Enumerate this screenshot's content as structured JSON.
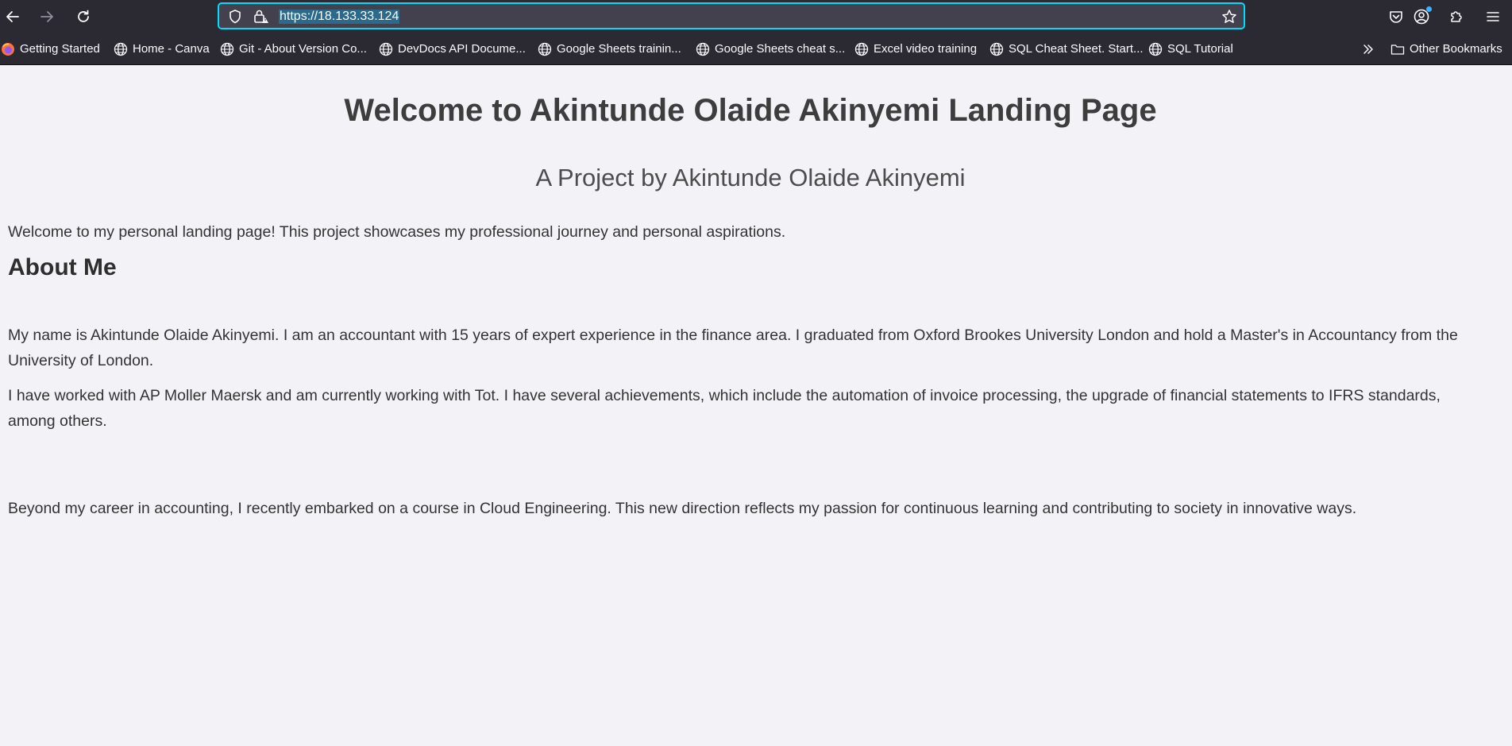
{
  "browser": {
    "url": "https://18.133.33.124",
    "bookmarks": [
      {
        "label": "Getting Started",
        "icon": "firefox-icon"
      },
      {
        "label": "Home - Canva",
        "icon": "globe-icon"
      },
      {
        "label": "Git - About Version Co...",
        "icon": "globe-icon"
      },
      {
        "label": "DevDocs API Docume...",
        "icon": "globe-icon"
      },
      {
        "label": "Google Sheets trainin...",
        "icon": "globe-icon"
      },
      {
        "label": "Google Sheets cheat s...",
        "icon": "globe-icon"
      },
      {
        "label": "Excel video training",
        "icon": "globe-icon"
      },
      {
        "label": "SQL Cheat Sheet. Start...",
        "icon": "globe-icon"
      },
      {
        "label": "SQL Tutorial",
        "icon": "globe-icon"
      }
    ],
    "other_bookmarks": "Other Bookmarks"
  },
  "page": {
    "title": "Welcome to Akintunde Olaide Akinyemi Landing Page",
    "subtitle": "A Project by Akintunde Olaide Akinyemi",
    "intro": "Welcome to my personal landing page! This project showcases my professional journey and personal aspirations.",
    "about_heading": "About Me",
    "paragraphs": [
      "My name is Akintunde Olaide Akinyemi. I am an accountant with 15 years of expert experience in the finance area. I graduated from Oxford Brookes University London and hold a Master's in Accountancy from the University of London.",
      "I have worked with AP Moller Maersk and am currently working with Tot. I have several achievements, which include the automation of invoice processing, the upgrade of financial statements to IFRS standards, among others.",
      "Beyond my career in accounting, I recently embarked on a course in Cloud Engineering. This new direction reflects my passion for continuous learning and contributing to society in innovative ways."
    ]
  },
  "colors": {
    "chrome_bg": "#2b2a33",
    "urlbar_bg": "#42414d",
    "focus_ring": "#00ddff",
    "page_bg": "#f3f2f7"
  }
}
